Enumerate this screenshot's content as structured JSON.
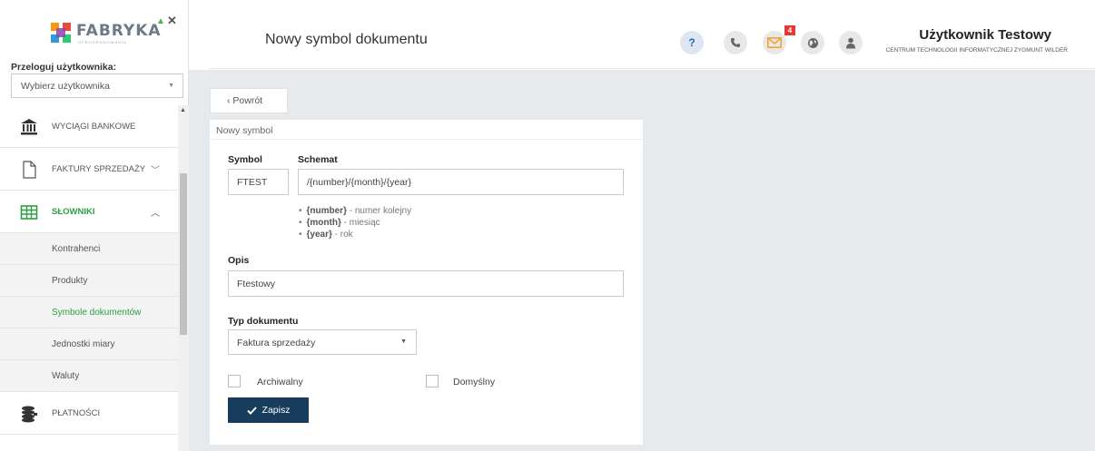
{
  "sidebar": {
    "logo": {
      "text": "FABRYKA",
      "subtext": "OPROGRAMOWANIA"
    },
    "impersonate_label": "Przeloguj użytkownika:",
    "user_select_value": "Wybierz użytkownika",
    "items": [
      {
        "label": "WYCIĄGI BANKOWE",
        "icon": "bank-icon"
      },
      {
        "label": "FAKTURY SPRZEDAŻY",
        "icon": "document-icon",
        "chevron": "﹀"
      },
      {
        "label": "SŁOWNIKI",
        "icon": "table-icon",
        "chevron": "︿",
        "active": true
      },
      {
        "label": "PŁATNOŚCI",
        "icon": "coins-icon"
      }
    ],
    "subitems": [
      {
        "label": "Kontrahenci"
      },
      {
        "label": "Produkty"
      },
      {
        "label": "Symbole dokumentów",
        "active": true
      },
      {
        "label": "Jednostki miary"
      },
      {
        "label": "Waluty"
      }
    ]
  },
  "header": {
    "title": "Nowy symbol dokumentu",
    "help_label": "?",
    "notifications_count": "4",
    "user_name": "Użytkownik Testowy",
    "company": "CENTRUM TECHNOLOGII INFORMATYCZNEJ ZYGMUNT WILDER"
  },
  "back_button": "‹  Powrót",
  "form": {
    "panel_title": "Nowy symbol",
    "symbol_label": "Symbol",
    "symbol_value": "FTEST",
    "schema_label": "Schemat",
    "schema_value": "/{number}/{month}/{year}",
    "legend": [
      {
        "key": "{number}",
        "desc": " - numer kolejny"
      },
      {
        "key": "{month}",
        "desc": " - miesiąc"
      },
      {
        "key": "{year}",
        "desc": " - rok"
      }
    ],
    "description_label": "Opis",
    "description_value": "Ftestowy",
    "doctype_label": "Typ dokumentu",
    "doctype_value": "Faktura sprzedaży",
    "archive_label": "Archiwalny",
    "default_label": "Domyślny",
    "save_label": "Zapisz"
  },
  "colors": {
    "accent_green": "#2e9e45",
    "save_button": "#173c5c",
    "badge_red": "#e53935",
    "main_bg": "#e7eaed"
  }
}
